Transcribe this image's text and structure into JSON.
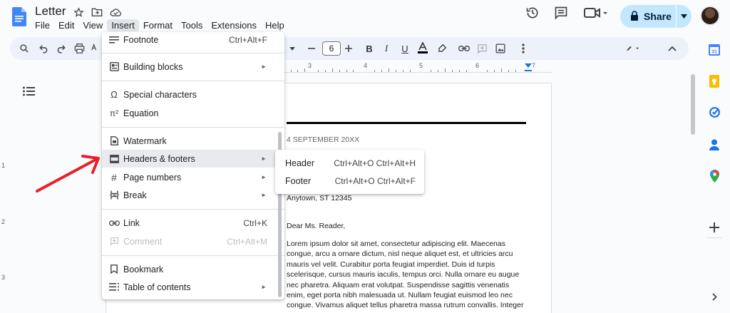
{
  "document": {
    "title": "Letter"
  },
  "menubar": {
    "items": [
      "File",
      "Edit",
      "View",
      "Insert",
      "Format",
      "Tools",
      "Extensions",
      "Help"
    ],
    "active": "Insert"
  },
  "share": {
    "label": "Share"
  },
  "toolbar": {
    "font_size": "6"
  },
  "ruler": {
    "numbers": [
      "3",
      "4",
      "5",
      "6",
      "7"
    ]
  },
  "vruler": {
    "numbers": [
      "1",
      "2",
      "3"
    ]
  },
  "insert_menu": {
    "items": [
      {
        "label": "Footnote",
        "shortcut": "Ctrl+Alt+F",
        "icon": "footnote-icon"
      },
      {
        "label": "Building blocks",
        "icon": "building-blocks-icon",
        "submenu": true
      },
      {
        "label": "Special characters",
        "icon": "omega-icon"
      },
      {
        "label": "Equation",
        "icon": "pi-squared-icon"
      },
      {
        "label": "Watermark",
        "icon": "watermark-icon"
      },
      {
        "label": "Headers & footers",
        "icon": "header-footer-icon",
        "submenu": true,
        "highlighted": true
      },
      {
        "label": "Page numbers",
        "icon": "hash-icon",
        "submenu": true
      },
      {
        "label": "Break",
        "icon": "break-icon",
        "submenu": true
      },
      {
        "label": "Link",
        "shortcut": "Ctrl+K",
        "icon": "link-icon"
      },
      {
        "label": "Comment",
        "shortcut": "Ctrl+Alt+M",
        "icon": "comment-icon",
        "disabled": true
      },
      {
        "label": "Bookmark",
        "icon": "bookmark-icon"
      },
      {
        "label": "Table of contents",
        "icon": "toc-icon",
        "submenu": true
      }
    ]
  },
  "headers_submenu": {
    "items": [
      {
        "label": "Header",
        "shortcut": "Ctrl+Alt+O Ctrl+Alt+H"
      },
      {
        "label": "Footer",
        "shortcut": "Ctrl+Alt+O Ctrl+Alt+F"
      }
    ]
  },
  "content": {
    "date": "4 SEPTEMBER 20XX",
    "address": "Anytown, ST 12345",
    "greeting": "Dear Ms. Reader,",
    "body": "Lorem ipsum dolor sit amet, consectetur adipiscing elit. Maecenas congue, arcu a ornare dictum, nisl neque aliquet est, et ultricies arcu mauris vel velit. Curabitur porta feugiat imperdiet. Duis id turpis scelerisque, cursus mauris iaculis, tempus orci. Nulla ornare eu augue nec pharetra. Aliquam erat volutpat. Suspendisse sagittis venenatis enim, eget porta nibh malesuada ut. Nullam feugiat euismod leo nec congue. Vivamus aliquet tellus pharetra massa rutrum convallis. Integer posuere"
  },
  "colors": {
    "share_bg": "#c2e7ff",
    "toolbar_bg": "#edf2fa",
    "menu_highlight": "#e8eaed",
    "arrow": "#e8202a"
  }
}
